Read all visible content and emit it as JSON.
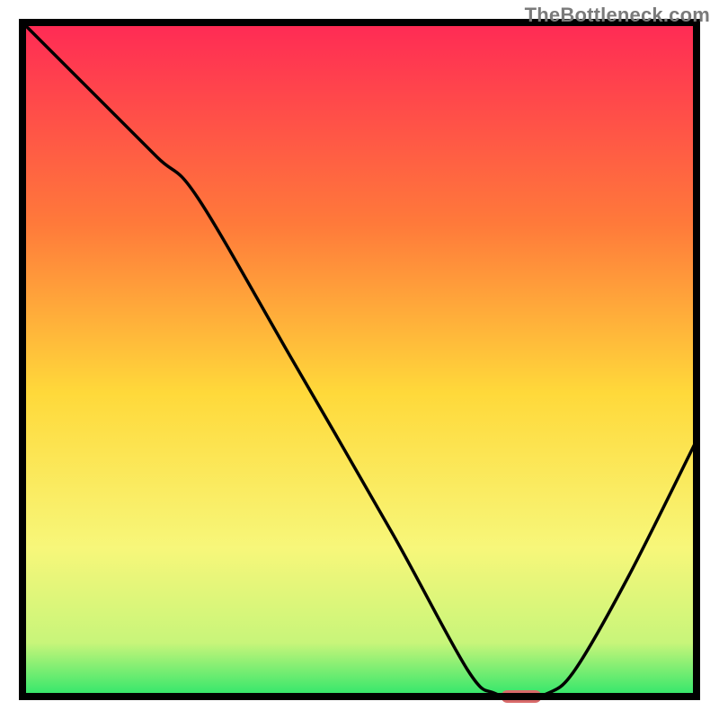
{
  "watermark": "TheBottleneck.com",
  "chart_data": {
    "type": "line",
    "title": "",
    "xlabel": "",
    "ylabel": "",
    "xlim": [
      0,
      100
    ],
    "ylim": [
      0,
      100
    ],
    "grid": false,
    "legend": false,
    "series": [
      {
        "name": "bottleneck-curve",
        "x": [
          0,
          10,
          20,
          26,
          40,
          55,
          66,
          70,
          74,
          78,
          82,
          90,
          100
        ],
        "y": [
          100,
          90,
          80,
          74,
          50,
          24,
          4,
          0.5,
          0,
          0.5,
          4,
          18,
          38
        ]
      }
    ],
    "highlight_zone": {
      "name": "optimal-range",
      "x_start": 71,
      "x_end": 77,
      "y": 0
    },
    "gradient_colors": {
      "top": "#ff2a55",
      "upper_mid": "#ff7a3a",
      "mid": "#ffd93a",
      "lower_mid": "#f7f77a",
      "near_bottom": "#c8f57a",
      "bottom": "#2ee66b"
    },
    "marker_color": "#d86a6a"
  }
}
